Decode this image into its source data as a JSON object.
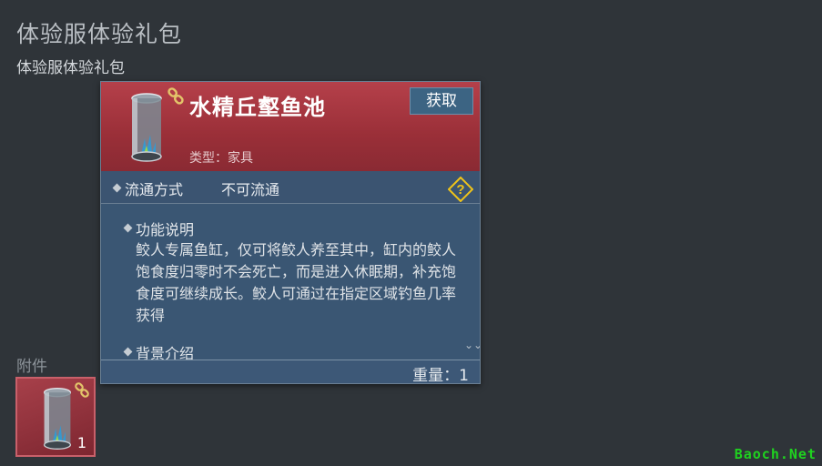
{
  "page": {
    "title": "体验服体验礼包",
    "subtitle": "体验服体验礼包"
  },
  "attachments": {
    "label": "附件",
    "slot": {
      "count": "1",
      "icon": "fish-tank-icon"
    }
  },
  "item": {
    "name": "水精丘壑鱼池",
    "type_label": "类型：家具",
    "obtain_label": "获取",
    "icon": "fish-tank-icon",
    "bound_icon": "chain-link-icon",
    "circulation_label": "流通方式",
    "circulation_value": "不可流通",
    "help_icon": "question-diamond-icon",
    "function_title": "功能说明",
    "function_text": "鲛人专属鱼缸，仅可将鲛人养至其中，缸内的鲛人饱食度归零时不会死亡，而是进入休眠期，补充饱食度可继续成长。鲛人可通过在指定区域钓鱼几率获得",
    "background_title": "背景介绍",
    "weight": "重量：1"
  },
  "watermark": "Baoch.Net",
  "colors": {
    "background": "#2f3439",
    "header_red": "#b5404a",
    "panel_blue": "#3a5673",
    "button_blue": "#3c6483",
    "help_yellow": "#f0c419",
    "watermark_green": "#1fd21f"
  }
}
